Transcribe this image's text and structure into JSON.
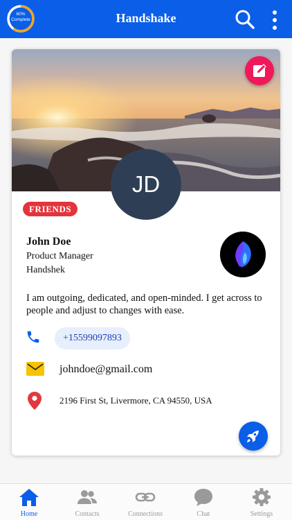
{
  "header": {
    "title": "Handshake",
    "progress_label": "60%\nComplete",
    "progress_fraction": 0.6,
    "icons": {
      "search": "search-icon",
      "more": "more-vertical-icon"
    }
  },
  "profile": {
    "initials": "JD",
    "badge": "FRIENDS",
    "name": "John Doe",
    "title": "Product Manager",
    "company": "Handshek",
    "bio": "I am outgoing, dedicated, and open-minded. I get across to people and adjust to changes with ease.",
    "phone": "+15599097893",
    "email": "johndoe@gmail.com",
    "address": "2196 First St, Livermore, CA 94550, USA"
  },
  "nav": {
    "items": [
      {
        "label": "Home",
        "icon": "home-icon",
        "active": true
      },
      {
        "label": "Contacts",
        "icon": "contacts-icon",
        "active": false
      },
      {
        "label": "Connections",
        "icon": "link-icon",
        "active": false
      },
      {
        "label": "Chat",
        "icon": "chat-icon",
        "active": false
      },
      {
        "label": "Settings",
        "icon": "gear-icon",
        "active": false
      }
    ]
  },
  "colors": {
    "primary": "#0a5ee8",
    "badge": "#e3343c",
    "edit": "#f0185a",
    "avatar": "#2e3f55",
    "phone_chip": "#e7eefc",
    "mail_icon": "#f6c400",
    "pin_icon": "#e0393e"
  }
}
